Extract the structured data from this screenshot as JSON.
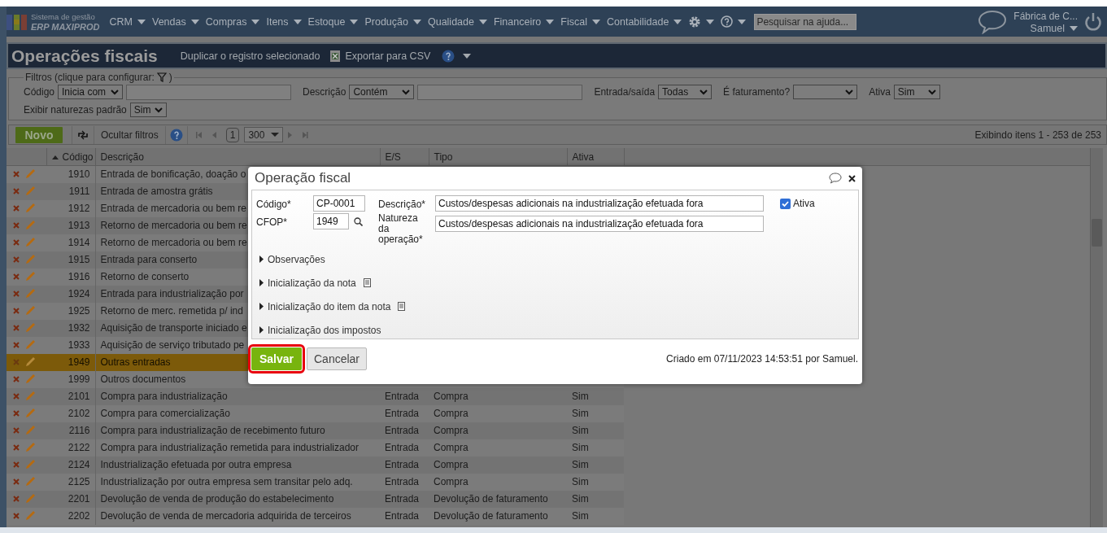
{
  "app": {
    "brand_top": "Sistema de gestão",
    "brand_name": "ERP MAXIPROD",
    "menu": [
      "CRM",
      "Vendas",
      "Compras",
      "Itens",
      "Estoque",
      "Produção",
      "Qualidade",
      "Financeiro",
      "Fiscal",
      "Contabilidade"
    ],
    "search": {
      "placeholder": "Pesquisar na ajuda..."
    },
    "company": "Fábrica de C...",
    "user": "Samuel"
  },
  "page": {
    "title": "Operações fiscais",
    "duplicate": "Duplicar o registro selecionado",
    "export": "Exportar para CSV"
  },
  "filters": {
    "legend": "Filtros (clique para configurar:",
    "legend_end": ")",
    "rows": [
      [
        {
          "kind": "text",
          "label": "Código",
          "operator": "Inicia com"
        },
        {
          "kind": "text",
          "label": "Descrição",
          "operator": "Contém"
        },
        {
          "kind": "select",
          "label": "Entrada/saída",
          "value": "Todas"
        },
        {
          "kind": "select",
          "label": "É faturamento?"
        },
        {
          "kind": "select",
          "label": "Ativa",
          "value": "Sim"
        }
      ],
      [
        {
          "kind": "select",
          "label": "Exibir naturezas padrão",
          "value": "Sim"
        }
      ]
    ]
  },
  "toolbar": {
    "new": "Novo",
    "hide_filters": "Ocultar filtros",
    "page": "1",
    "page_size": "300",
    "status": "Exibindo itens 1 - 253 de 253"
  },
  "table": {
    "columns": [
      {
        "label": "Código",
        "sorted": true
      },
      {
        "label": "Descrição",
        "sorted": false
      },
      {
        "label": "E/S",
        "sorted": false
      },
      {
        "label": "Tipo",
        "sorted": false
      },
      {
        "label": "Ativa",
        "sorted": false
      }
    ],
    "rows": [
      {
        "code": "1910",
        "description": "Entrada de bonificação, doação o",
        "selected": false
      },
      {
        "code": "1911",
        "description": "Entrada de amostra grátis",
        "selected": false
      },
      {
        "code": "1912",
        "description": "Entrada de mercadoria ou bem re",
        "selected": false
      },
      {
        "code": "1913",
        "description": "Retorno de mercadoria ou bem re",
        "selected": false
      },
      {
        "code": "1914",
        "description": "Retorno de mercadoria ou bem re",
        "selected": false
      },
      {
        "code": "1915",
        "description": "Entrada para conserto",
        "selected": false
      },
      {
        "code": "1916",
        "description": "Retorno de conserto",
        "selected": false
      },
      {
        "code": "1924",
        "description": "Entrada para industrialização por",
        "selected": false
      },
      {
        "code": "1925",
        "description": "Retorno de merc. remetida p/ ind",
        "selected": false
      },
      {
        "code": "1932",
        "description": "Aquisição de transporte iniciado e",
        "selected": false
      },
      {
        "code": "1933",
        "description": "Aquisição de serviço tributado pe",
        "selected": false
      },
      {
        "code": "1949",
        "description": "Outras entradas",
        "selected": true
      },
      {
        "code": "1999",
        "description": "Outros documentos",
        "selected": false
      },
      {
        "code": "2101",
        "description": "Compra para industrialização",
        "es": "Entrada",
        "tipo": "Compra",
        "ativa": "Sim",
        "selected": false
      },
      {
        "code": "2102",
        "description": "Compra para comercialização",
        "es": "Entrada",
        "tipo": "Compra",
        "ativa": "Sim",
        "selected": false
      },
      {
        "code": "2116",
        "description": "Compra para industrialização de recebimento futuro",
        "es": "Entrada",
        "tipo": "Compra",
        "ativa": "Sim",
        "selected": false
      },
      {
        "code": "2122",
        "description": "Compra para industrialização remetida para industrializador",
        "es": "Entrada",
        "tipo": "Compra",
        "ativa": "Sim",
        "selected": false
      },
      {
        "code": "2124",
        "description": "Industrialização efetuada por outra empresa",
        "es": "Entrada",
        "tipo": "Compra",
        "ativa": "Sim",
        "selected": false
      },
      {
        "code": "2125",
        "description": "Industrialização por outra empresa sem transitar pelo adq.",
        "es": "Entrada",
        "tipo": "Compra",
        "ativa": "Sim",
        "selected": false
      },
      {
        "code": "2201",
        "description": "Devolução de venda de produção do estabelecimento",
        "es": "Entrada",
        "tipo": "Devolução de faturamento",
        "ativa": "Sim",
        "selected": false
      },
      {
        "code": "2202",
        "description": "Devolução de venda de mercadoria adquirida de terceiros",
        "es": "Entrada",
        "tipo": "Devolução de faturamento",
        "ativa": "Sim",
        "selected": false
      }
    ]
  },
  "dialog": {
    "title": "Operação fiscal",
    "codigo": {
      "label": "Código*",
      "value": "CP-0001"
    },
    "cfop": {
      "label": "CFOP*",
      "value": "1949"
    },
    "descricao": {
      "label": "Descrição*",
      "value": "Custos/despesas adicionais na industrialização efetuada fora"
    },
    "natureza": {
      "label": "Natureza da operação*",
      "value": "Custos/despesas adicionais na industrialização efetuada fora"
    },
    "ativa": {
      "label": "Ativa",
      "checked": true
    },
    "sections": [
      {
        "label": "Observações",
        "expanded": false,
        "note": false
      },
      {
        "label": "Inicialização da nota",
        "expanded": false,
        "note": true
      },
      {
        "label": "Inicialização do item da nota",
        "expanded": false,
        "note": true
      },
      {
        "label": "Inicialização dos impostos",
        "expanded": false,
        "note": false
      }
    ],
    "save": {
      "label": "Salvar",
      "highlighted": true
    },
    "cancel": "Cancelar",
    "footer": "Criado em 07/11/2023 14:53:51 por Samuel."
  }
}
